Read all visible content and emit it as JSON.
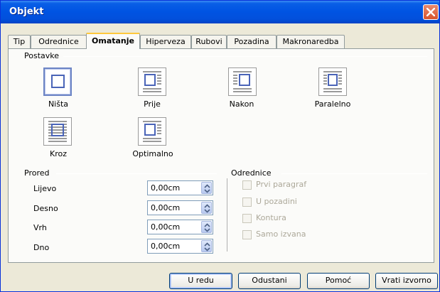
{
  "window": {
    "title": "Objekt",
    "close_icon": "close-icon"
  },
  "tabs": [
    {
      "label": "Tip",
      "active": false
    },
    {
      "label": "Odrednice",
      "active": false
    },
    {
      "label": "Omatanje",
      "active": true
    },
    {
      "label": "Hiperveza",
      "active": false
    },
    {
      "label": "Rubovi",
      "active": false
    },
    {
      "label": "Pozadina",
      "active": false
    },
    {
      "label": "Makronaredba",
      "active": false
    }
  ],
  "postavke": {
    "heading": "Postavke",
    "options": [
      {
        "label": "Ništa",
        "icon": "wrap-none-icon",
        "selected": true
      },
      {
        "label": "Prije",
        "icon": "wrap-before-icon",
        "selected": false
      },
      {
        "label": "Nakon",
        "icon": "wrap-after-icon",
        "selected": false
      },
      {
        "label": "Paralelno",
        "icon": "wrap-parallel-icon",
        "selected": false
      },
      {
        "label": "Kroz",
        "icon": "wrap-through-icon",
        "selected": false
      },
      {
        "label": "Optimalno",
        "icon": "wrap-optimal-icon",
        "selected": false
      }
    ]
  },
  "prored": {
    "heading": "Prored",
    "fields": [
      {
        "label": "Lijevo",
        "value": "0,00cm"
      },
      {
        "label": "Desno",
        "value": "0,00cm"
      },
      {
        "label": "Vrh",
        "value": "0,00cm"
      },
      {
        "label": "Dno",
        "value": "0,00cm"
      }
    ]
  },
  "odrednice": {
    "heading": "Odrednice",
    "checkboxes": [
      {
        "label": "Prvi paragraf",
        "checked": false,
        "enabled": false
      },
      {
        "label": "U pozadini",
        "checked": false,
        "enabled": false
      },
      {
        "label": "Kontura",
        "checked": false,
        "enabled": false
      },
      {
        "label": "Samo izvana",
        "checked": false,
        "enabled": false
      }
    ]
  },
  "buttons": {
    "ok": "U redu",
    "cancel": "Odustani",
    "help": "Pomoć",
    "reset": "Vrati izvorno"
  },
  "colors": {
    "titlebar": "#0054e3",
    "dialog_bg": "#ece9d8",
    "active_tab_accent": "#ffc83c",
    "icon_blue": "#6d85c5"
  }
}
